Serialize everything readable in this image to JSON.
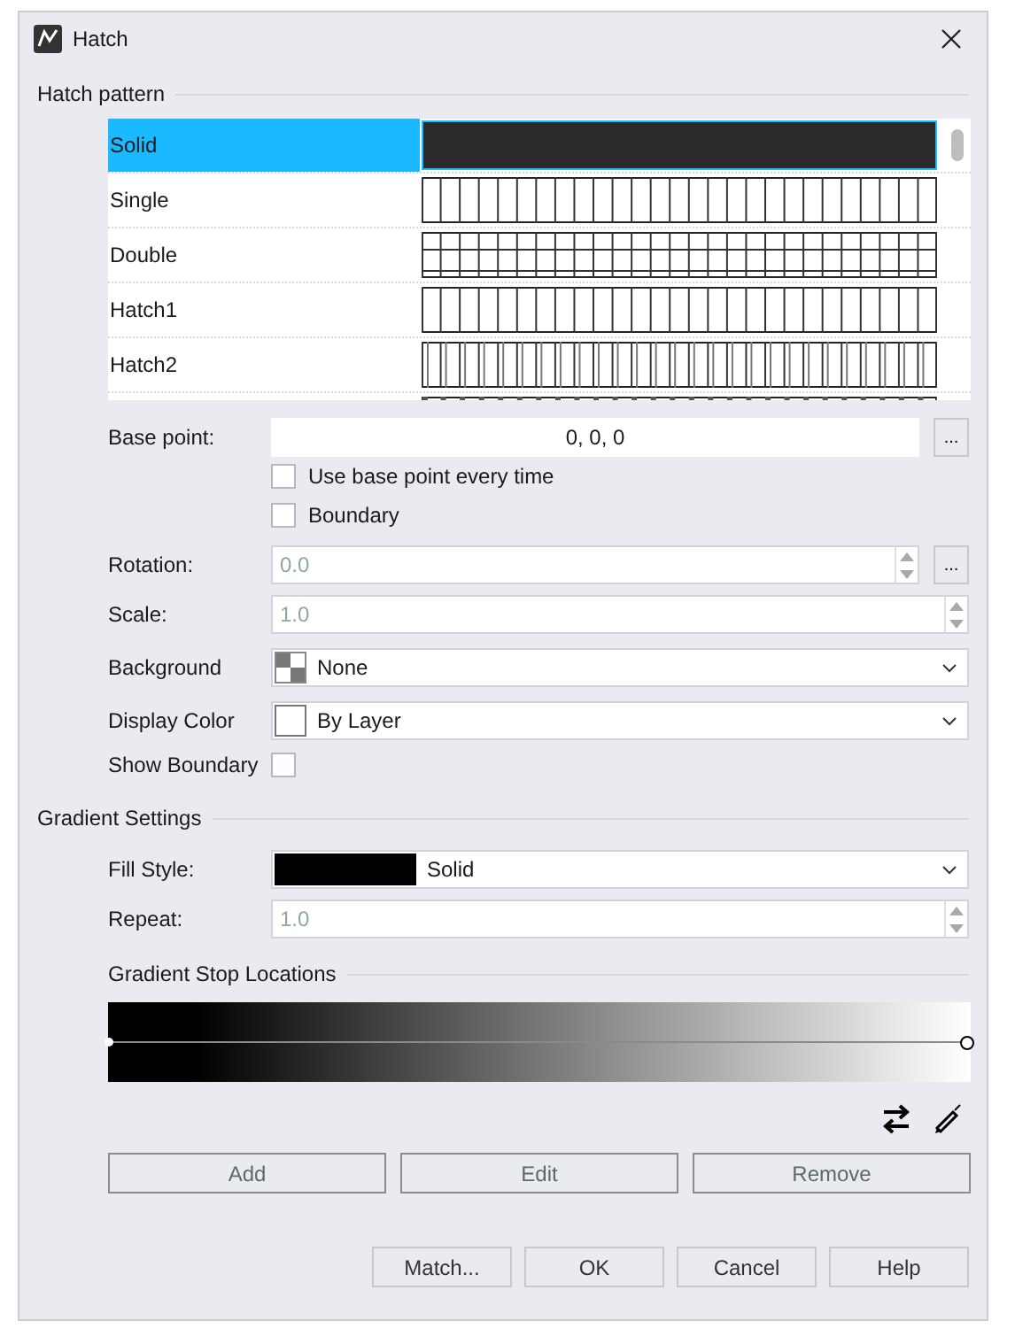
{
  "window": {
    "title": "Hatch"
  },
  "hatch_pattern": {
    "title": "Hatch pattern",
    "items": [
      {
        "name": "Solid",
        "kind": "solid",
        "selected": true
      },
      {
        "name": "Single",
        "kind": "single",
        "selected": false
      },
      {
        "name": "Double",
        "kind": "double",
        "selected": false
      },
      {
        "name": "Hatch1",
        "kind": "single",
        "selected": false
      },
      {
        "name": "Hatch2",
        "kind": "pairs",
        "selected": false
      },
      {
        "kind": "thick",
        "selected": false
      }
    ]
  },
  "fields": [
    {
      "kind": "point",
      "label": "Base point:",
      "value": "0, 0, 0",
      "button": "..."
    },
    {
      "kind": "checkbox",
      "label": "Use base point every time",
      "checked": false
    },
    {
      "kind": "checkbox",
      "label": "Boundary",
      "checked": false
    },
    {
      "kind": "spin",
      "label": "Rotation:",
      "value": "0.0",
      "disabled": true,
      "button": "..."
    },
    {
      "kind": "spin",
      "label": "Scale:",
      "value": "1.0",
      "disabled": true
    },
    {
      "kind": "dropdown",
      "label": "Background",
      "value": "None",
      "swatch": {
        "kind": "checker"
      }
    },
    {
      "kind": "dropdown",
      "label": "Display Color",
      "value": "By Layer",
      "swatch": {
        "kind": "blank"
      }
    },
    {
      "kind": "check-after",
      "label": "Show Boundary",
      "checked": false
    }
  ],
  "gradient": {
    "title": "Gradient Settings",
    "fields": [
      {
        "kind": "dropdown",
        "label": "Fill Style:",
        "value": "Solid",
        "swatch": {
          "kind": "black-bar"
        }
      },
      {
        "kind": "spin",
        "label": "Repeat:",
        "value": "1.0",
        "disabled": true
      }
    ],
    "stops_title": "Gradient Stop Locations",
    "buttons": [
      "Add",
      "Edit",
      "Remove"
    ]
  },
  "footer_buttons": [
    "Match...",
    "OK",
    "Cancel",
    "Help"
  ]
}
